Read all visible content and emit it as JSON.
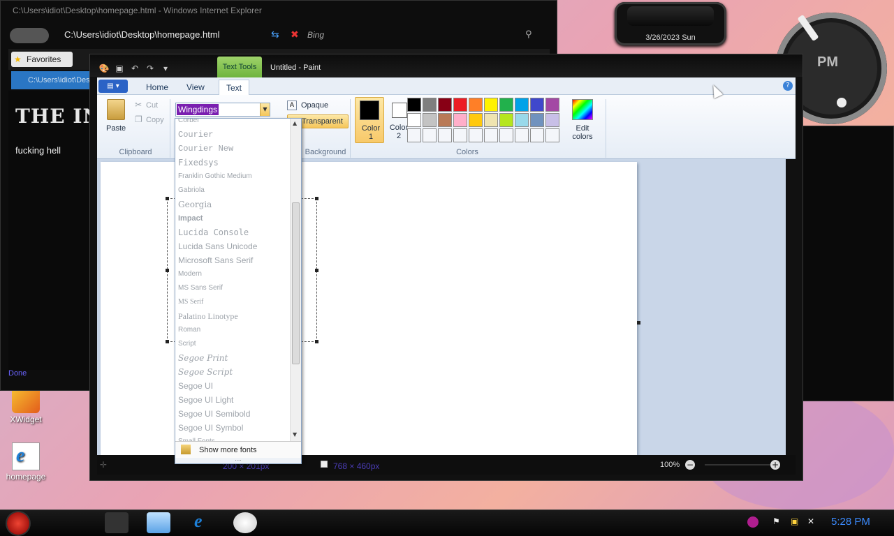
{
  "widget": {
    "date": "3/26/2023 Sun",
    "clock_label": "PM"
  },
  "desktop_icons": [
    {
      "label": "XWidget"
    },
    {
      "label": "homepage"
    }
  ],
  "ie": {
    "title": "C:\\Users\\idiot\\Desktop\\homepage.html - Windows Internet Explorer",
    "address": "C:\\Users\\idiot\\Desktop\\homepage.html",
    "search_provider": "Bing",
    "favorites_label": "Favorites",
    "tab_label": "C:\\Users\\idiot\\Desktop\\homepage.html",
    "heading": "THE INT",
    "body_text": "fucking hell",
    "status": "Done"
  },
  "paint": {
    "context_tab": "Text Tools",
    "title": "Untitled - Paint",
    "tabs": [
      {
        "label": "Home"
      },
      {
        "label": "View"
      },
      {
        "label": "Text"
      }
    ],
    "clipboard": {
      "paste": "Paste",
      "cut": "Cut",
      "copy": "Copy",
      "group": "Clipboard"
    },
    "font": {
      "selected": "Wingdings"
    },
    "background": {
      "opaque": "Opaque",
      "transparent": "Transparent",
      "group": "Background"
    },
    "colors": {
      "color1": "Color 1",
      "color2": "Color 2",
      "edit": "Edit colors",
      "group": "Colors",
      "color1_value": "#000000",
      "color2_value": "#ffffff",
      "palette": [
        "#000000",
        "#7f7f7f",
        "#880015",
        "#ed1c24",
        "#ff7f27",
        "#fff200",
        "#22b14c",
        "#00a2e8",
        "#3f48cc",
        "#a349a4",
        "#ffffff",
        "#c3c3c3",
        "#b97a57",
        "#ffaec9",
        "#ffc90e",
        "#efe4b0",
        "#b5e61d",
        "#99d9ea",
        "#7092be",
        "#c8bfe7",
        "#f4f6fa",
        "#f4f6fa",
        "#f4f6fa",
        "#f4f6fa",
        "#f4f6fa",
        "#f4f6fa",
        "#f4f6fa",
        "#f4f6fa",
        "#f4f6fa",
        "#f4f6fa"
      ]
    },
    "font_list": [
      "Corbel",
      "Courier",
      "Courier New",
      "Fixedsys",
      "Franklin Gothic Medium",
      "Gabriola",
      "Georgia",
      "Impact",
      "Lucida Console",
      "Lucida Sans Unicode",
      "Microsoft Sans Serif",
      "Modern",
      "MS Sans Serif",
      "MS Serif",
      "Palatino Linotype",
      "Roman",
      "Script",
      "Segoe Print",
      "Segoe Script",
      "Segoe UI",
      "Segoe UI Light",
      "Segoe UI Semibold",
      "Segoe UI Symbol",
      "Small Fonts"
    ],
    "show_more_fonts": "Show more fonts",
    "status": {
      "selection_size": "200 × 201px",
      "canvas_size": "768 × 460px",
      "zoom": "100%"
    }
  },
  "taskbar": {
    "time": "5:28 PM"
  }
}
